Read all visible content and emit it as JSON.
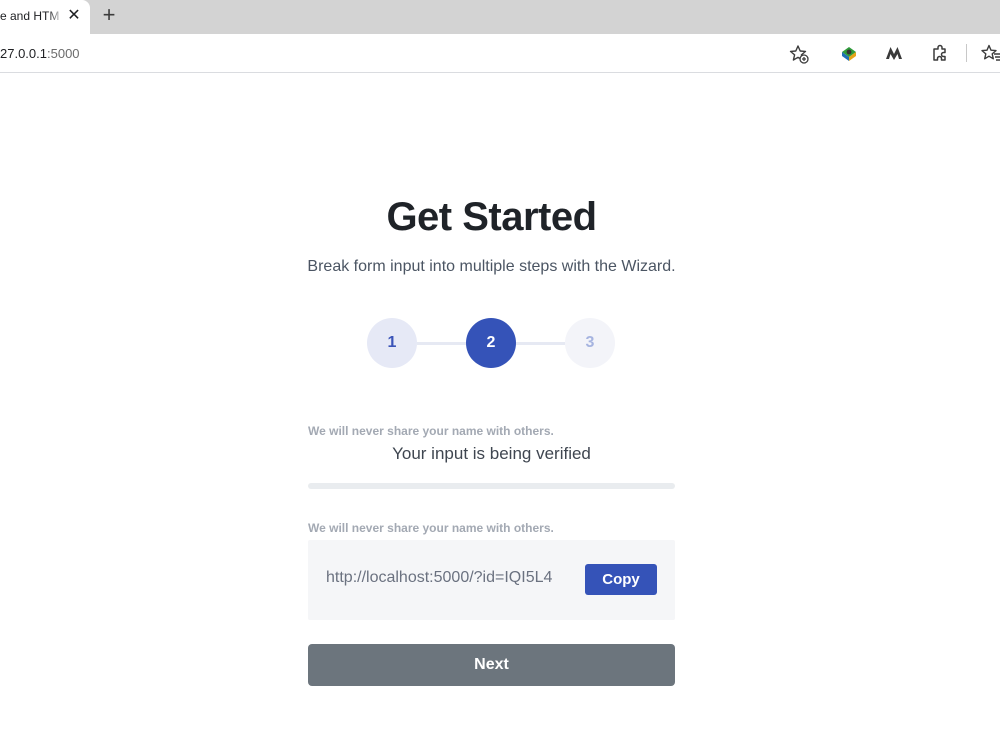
{
  "browser": {
    "tab_title": "e and HTM",
    "url_host": "27.0.0.1",
    "url_port": ":5000",
    "icons": [
      "close-icon",
      "plus-icon",
      "favorite-add-icon",
      "extension-icon",
      "m-extension-icon",
      "puzzle-icon",
      "favorites-icon"
    ]
  },
  "page": {
    "title": "Get Started",
    "subtitle": "Break form input into multiple steps with the Wizard.",
    "steps": [
      {
        "label": "1",
        "state": "done"
      },
      {
        "label": "2",
        "state": "active"
      },
      {
        "label": "3",
        "state": "upcoming"
      }
    ],
    "hint_1": "We will never share your name with others.",
    "verify_message": "Your input is being verified",
    "progress": 0,
    "hint_2": "We will never share your name with others.",
    "link_value": "http://localhost:5000/?id=IQI5L4",
    "copy_label": "Copy",
    "next_label": "Next"
  },
  "colors": {
    "accent": "#3553b8",
    "next_button": "#6c757d",
    "step_done_bg": "#e6e9f6",
    "step_upcoming_bg": "#f3f4f9"
  }
}
